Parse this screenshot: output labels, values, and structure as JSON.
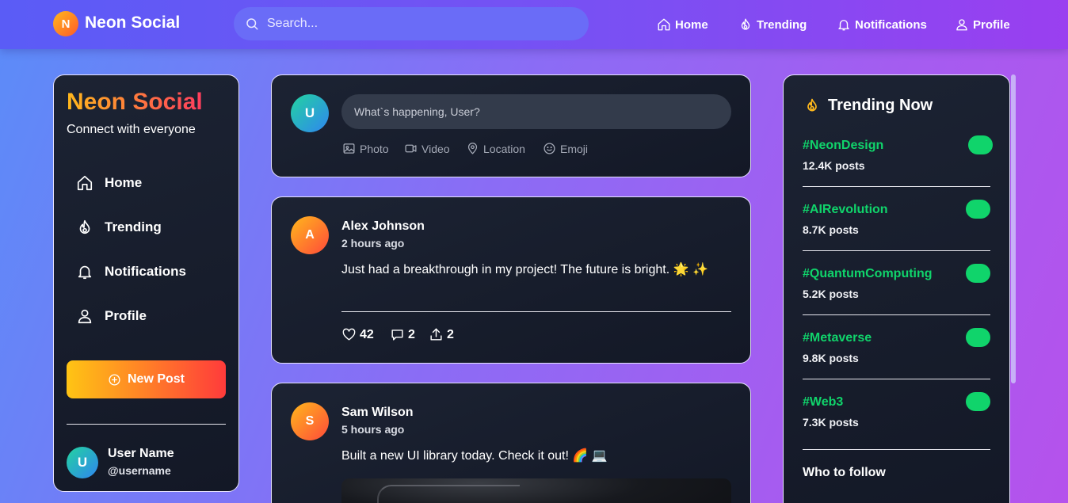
{
  "app": {
    "logo_letter": "N",
    "name": "Neon Social"
  },
  "search": {
    "placeholder": "Search..."
  },
  "topnav": [
    {
      "label": "Home",
      "icon": "home-icon"
    },
    {
      "label": "Trending",
      "icon": "fire-icon"
    },
    {
      "label": "Notifications",
      "icon": "bell-icon"
    },
    {
      "label": "Profile",
      "icon": "user-icon"
    }
  ],
  "sidebar": {
    "title": "Neon Social",
    "tagline": "Connect with everyone",
    "items": [
      {
        "label": "Home",
        "icon": "home-icon"
      },
      {
        "label": "Trending",
        "icon": "fire-icon"
      },
      {
        "label": "Notifications",
        "icon": "bell-icon"
      },
      {
        "label": "Profile",
        "icon": "user-icon"
      }
    ],
    "new_post_label": "New Post",
    "user": {
      "initial": "U",
      "name": "User Name",
      "handle": "@username"
    }
  },
  "composer": {
    "avatar_initial": "U",
    "placeholder": "What`s happening, User?",
    "attachments": [
      {
        "label": "Photo",
        "icon": "image-icon"
      },
      {
        "label": "Video",
        "icon": "video-icon"
      },
      {
        "label": "Location",
        "icon": "location-pin-icon"
      },
      {
        "label": "Emoji",
        "icon": "smiley-icon"
      }
    ]
  },
  "posts": [
    {
      "initial": "A",
      "author": "Alex Johnson",
      "time": "2 hours ago",
      "text": "Just had a breakthrough in my project! The future is bright. 🌟 ✨",
      "likes": "42",
      "comments": "2",
      "shares": "2"
    },
    {
      "initial": "S",
      "author": "Sam Wilson",
      "time": "5 hours ago",
      "text": "Built a new UI library today. Check it out! 🌈 💻"
    }
  ],
  "trending": {
    "title": "Trending Now",
    "items": [
      {
        "tag": "#NeonDesign",
        "count": "12.4K posts"
      },
      {
        "tag": "#AIRevolution",
        "count": "8.7K posts"
      },
      {
        "tag": "#QuantumComputing",
        "count": "5.2K posts"
      },
      {
        "tag": "#Metaverse",
        "count": "9.8K posts"
      },
      {
        "tag": "#Web3",
        "count": "7.3K posts"
      }
    ],
    "who_to_follow_title": "Who to follow"
  },
  "colors": {
    "accent_green": "#10d46b",
    "card_bg": "#1c2333",
    "topbar": "#6a52f5"
  }
}
